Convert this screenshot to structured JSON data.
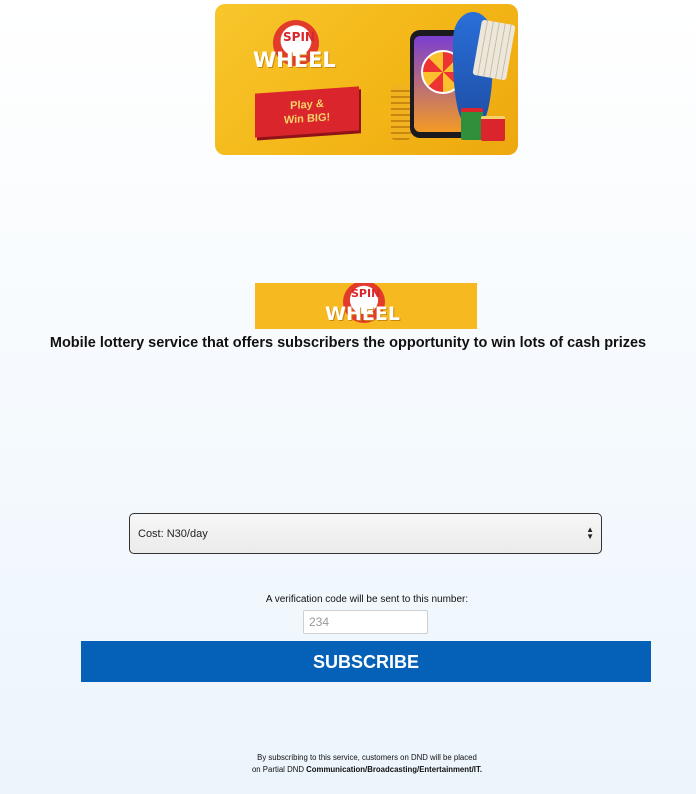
{
  "banner": {
    "logo_top": "SPIN",
    "logo_bottom": "WHEEL",
    "ribbon_line1": "Play &",
    "ribbon_line2": "Win BIG!"
  },
  "small_logo": {
    "logo_top": "SPIN",
    "logo_bottom": "WHEEL"
  },
  "tagline": "Mobile lottery service that offers subscribers the opportunity to win lots of cash prizes",
  "plan_select": {
    "selected": "Cost: N30/day"
  },
  "verification": {
    "label": "A verification code will be sent to this number:",
    "phone_value": "234"
  },
  "subscribe_label": "SUBSCRIBE",
  "footer": {
    "line1": "By subscribing to this service, customers on DND will be placed",
    "line2_prefix": "on Partial DND ",
    "line2_bold": "Communication/Broadcasting/Entertainment/IT."
  },
  "colors": {
    "brand_yellow": "#f6b91f",
    "button_blue": "#0560b7",
    "ribbon_red": "#d9252b"
  }
}
